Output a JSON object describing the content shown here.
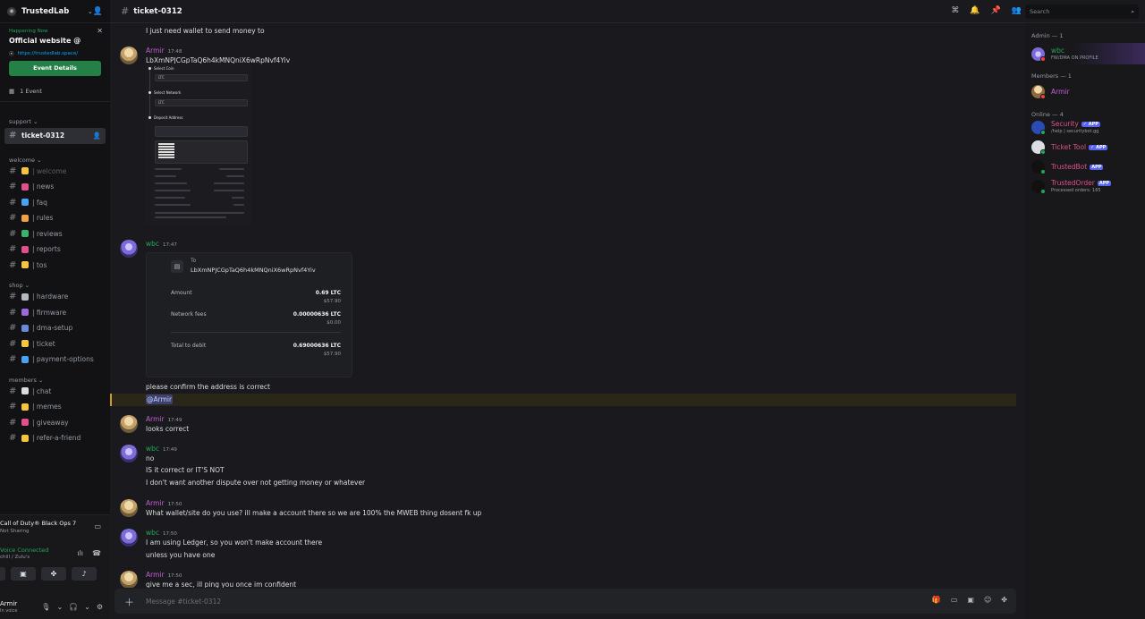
{
  "server": {
    "name": "TrustedLab"
  },
  "event": {
    "happening": "Happening Now",
    "title": "Official website @",
    "link": "https://trustedlab.space/",
    "button": "Event Details",
    "events_count": "1 Event"
  },
  "categories": {
    "support": "support",
    "welcome": "welcome",
    "shop": "shop",
    "members": "members"
  },
  "channels": {
    "support": [
      {
        "label": "ticket-0312"
      }
    ],
    "welcome": [
      {
        "label": "| welcome",
        "emoji_color": "#f5c542"
      },
      {
        "label": "| news",
        "emoji_color": "#e0508a"
      },
      {
        "label": "| faq",
        "emoji_color": "#4aa3f0"
      },
      {
        "label": "| rules",
        "emoji_color": "#f0a04a"
      },
      {
        "label": "| reviews",
        "emoji_color": "#3bb36a"
      },
      {
        "label": "| reports",
        "emoji_color": "#e0508a"
      },
      {
        "label": "| tos",
        "emoji_color": "#f5c542"
      }
    ],
    "shop": [
      {
        "label": "| hardware",
        "emoji_color": "#b5bac1"
      },
      {
        "label": "| firmware",
        "emoji_color": "#9b6ad8"
      },
      {
        "label": "| dma-setup",
        "emoji_color": "#6a8ad8"
      },
      {
        "label": "| ticket",
        "emoji_color": "#f5c542"
      },
      {
        "label": "| payment-options",
        "emoji_color": "#4aa3f0"
      }
    ],
    "members": [
      {
        "label": "| chat",
        "emoji_color": "#dbdee1"
      },
      {
        "label": "| memes",
        "emoji_color": "#f5c542"
      },
      {
        "label": "| giveaway",
        "emoji_color": "#e0508a"
      },
      {
        "label": "| refer-a-friend",
        "emoji_color": "#f5c542"
      }
    ]
  },
  "activity": {
    "title": "Call of Duty® Black Ops 7",
    "sub": "Not Sharing"
  },
  "voice": {
    "title": "Voice Connected",
    "sub": "chill / Zulu's"
  },
  "user": {
    "name": "Armir",
    "status": "In voice"
  },
  "topbar": {
    "channel": "ticket-0312",
    "search_placeholder": "Search"
  },
  "messages": {
    "m0": "I just need wallet to send money to",
    "armir": "Armir",
    "wbc": "wbc",
    "t1": "17:48",
    "m1": "LbXmNPJCGpTaQ6h4kMNQniX6wRpNvf4Yiv",
    "t2": "17:47",
    "t3": "17:49",
    "t4": "17:49",
    "t5": "17:50",
    "t6": "17:50",
    "t7": "17:50",
    "confirm": "please confirm the address is correct",
    "mention": "@Armir",
    "looks": "looks correct",
    "no": "no",
    "is_it": "IS it correct or IT'S NOT",
    "dispute": "I don't want another dispute over not getting money or whatever",
    "what_wallet": "What wallet/site do you use? ill make a account there so we are 100% the MWEB thing dosent fk up",
    "ledger": "I am using Ledger, so you won't make account there",
    "unless": "unless you have one",
    "give_me": "give me a sec, ill ping you once im confident"
  },
  "attachment": {
    "select_coin": "Select Coin",
    "select_network": "Select Network",
    "deposit_address": "Deposit Address",
    "coin_value": "LTC",
    "network_value": "LTC"
  },
  "embed": {
    "to_label": "To",
    "to_address": "LbXmNPJCGpTaQ6h4kMNQniX6wRpNvf4Yiv",
    "amount_label": "Amount",
    "amount_value": "0.69 LTC",
    "amount_usd": "$57.90",
    "fees_label": "Network fees",
    "fees_value": "0.00000636 LTC",
    "fees_usd": "$0.00",
    "total_label": "Total to debit",
    "total_value": "0.69000636 LTC",
    "total_usd": "$57.90"
  },
  "composer": {
    "placeholder": "Message #ticket-0312"
  },
  "members": {
    "admin_header": "Admin — 1",
    "admin": {
      "name": "wbc",
      "sub": "FW/DMA ON PROFILE",
      "color": "#23a55a"
    },
    "members_header": "Members — 1",
    "member": {
      "name": "Armir",
      "color": "#c05fd2"
    },
    "online_header": "Online — 4",
    "online": [
      {
        "name": "Security",
        "tag": "✓ APP",
        "sub": "/help | securitybot.gg",
        "color": "#e0508a"
      },
      {
        "name": "Ticket Tool",
        "tag": "✓ APP",
        "sub": "",
        "color": "#e0508a"
      },
      {
        "name": "TrustedBot",
        "tag": "APP",
        "sub": "",
        "color": "#e0508a"
      },
      {
        "name": "TrustedOrder",
        "tag": "APP",
        "sub": "Processed orders: 165",
        "color": "#e0508a"
      }
    ]
  }
}
